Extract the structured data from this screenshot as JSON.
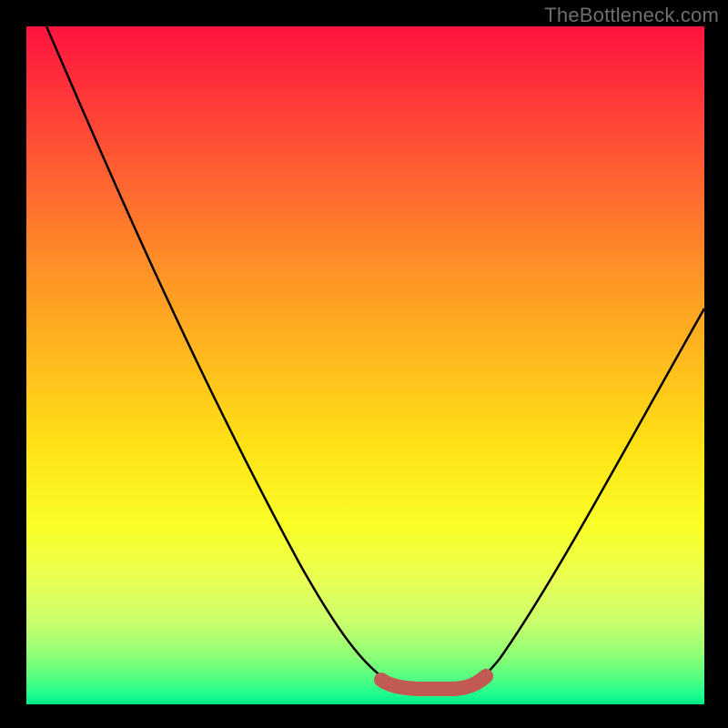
{
  "watermark": "TheBottleneck.com",
  "chart_data": {
    "type": "line",
    "title": "",
    "xlabel": "",
    "ylabel": "",
    "xlim": [
      0,
      100
    ],
    "ylim": [
      0,
      100
    ],
    "x": [
      3,
      10,
      20,
      30,
      40,
      48,
      53,
      56,
      60,
      64,
      67,
      74,
      82,
      90,
      98
    ],
    "values": [
      100,
      84,
      65,
      47,
      28,
      12,
      3,
      1,
      0.5,
      1,
      3,
      14,
      28,
      43,
      58
    ],
    "series": [
      {
        "name": "bottleneck-curve",
        "x": [
          3,
          10,
          20,
          30,
          40,
          48,
          53,
          56,
          60,
          64,
          67,
          74,
          82,
          90,
          98
        ],
        "values": [
          100,
          84,
          65,
          47,
          28,
          12,
          3,
          1,
          0.5,
          1,
          3,
          14,
          28,
          43,
          58
        ]
      }
    ],
    "highlight_band": {
      "x_start": 53,
      "x_end": 67,
      "color": "#c45a54"
    }
  }
}
